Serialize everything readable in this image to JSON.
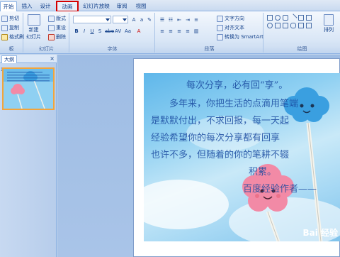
{
  "tabs": [
    "开始",
    "插入",
    "设计",
    "动画",
    "幻灯片放映",
    "审阅",
    "视图"
  ],
  "ribbon": {
    "clipboard": {
      "cut": "剪切",
      "copy": "复制",
      "format_painter": "格式刷",
      "label": "板"
    },
    "slides": {
      "new_slide": "新建",
      "new_slide2": "幻灯片",
      "layout": "版式",
      "reset": "重设",
      "delete": "删除",
      "label": "幻灯片"
    },
    "font": {
      "label": "字体"
    },
    "paragraph": {
      "text_direction": "文字方向",
      "align_text": "对齐文本",
      "smartart": "转换为 SmartArt",
      "label": "段落"
    },
    "drawing": {
      "arrange": "排列",
      "label": "绘图"
    }
  },
  "pane": {
    "tab_label": "大纲",
    "close": "×",
    "slide_number": "1"
  },
  "slide_text": {
    "title": "每次分享，必有回“享”。",
    "line1": "多年来，你把生活的点滴用笔端",
    "line2": "是默默付出，不求回报，每一天起",
    "line3": "经验希望你的每次分享都有回享",
    "line4": "也许不多，但随着的你的笔耕不辍",
    "line5": "积累。",
    "line6": "百度经验作者——"
  },
  "watermark": "Bai 经验",
  "colors": {
    "highlight_box": "#d40000",
    "thumbnail_border": "#f2a53c",
    "cloud_blue": "#3a9fe0",
    "cloud_pink": "#f28aa6"
  }
}
